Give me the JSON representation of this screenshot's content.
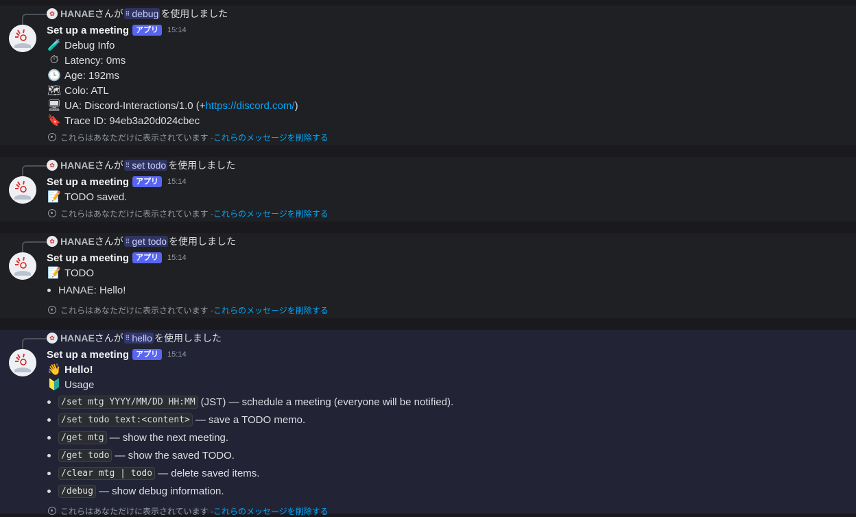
{
  "author": "Set up a meeting",
  "app_badge": "アプリ",
  "time": "15:14",
  "reply_user": "HANAE",
  "reply_mid": "さんが",
  "reply_suffix": "を使用しました",
  "ephemeral_text": "これらはあなただけに表示されています · ",
  "delete_link": "これらのメッセージを削除する",
  "messages": [
    {
      "command": "debug",
      "lines": {
        "title": "Debug Info",
        "latency": "Latency: 0ms",
        "age": "Age: 192ms",
        "colo": "Colo: ATL",
        "ua_prefix": "UA: Discord-Interactions/1.0 (+",
        "ua_link": "https://discord.com/",
        "ua_suffix": ")",
        "trace": "Trace ID: 94eb3a20d024cbec"
      }
    },
    {
      "command": "set todo",
      "lines": {
        "saved": "TODO saved."
      }
    },
    {
      "command": "get todo",
      "lines": {
        "title": "TODO",
        "item": "HANAE: Hello!"
      }
    },
    {
      "command": "hello",
      "lines": {
        "hello": "Hello!",
        "usage": "Usage"
      },
      "items": [
        {
          "code": "/set mtg YYYY/MM/DD HH:MM",
          "text": " (JST) — schedule a meeting (everyone will be notified)."
        },
        {
          "code": "/set todo text:<content>",
          "text": " — save a TODO memo."
        },
        {
          "code": "/get mtg",
          "text": " — show the next meeting."
        },
        {
          "code": "/get todo",
          "text": " — show the saved TODO."
        },
        {
          "code": "/clear mtg | todo",
          "text": " — delete saved items."
        },
        {
          "code": "/debug",
          "text": " — show debug information."
        }
      ]
    }
  ]
}
